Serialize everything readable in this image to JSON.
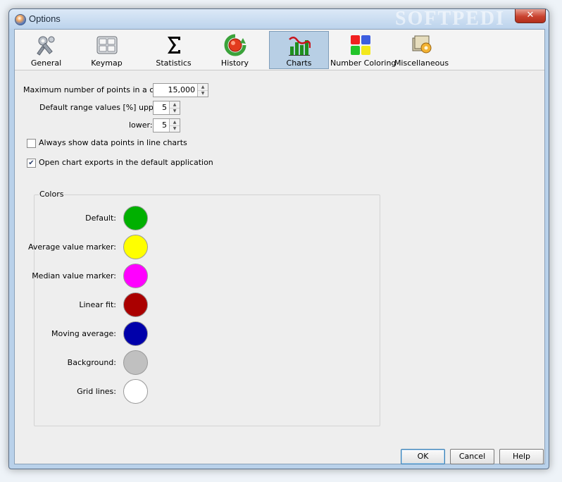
{
  "window": {
    "title": "Options",
    "watermark": "SOFTPEDI",
    "close_glyph": "✕"
  },
  "tabs": [
    {
      "label": "General",
      "icon": "wrench-icon"
    },
    {
      "label": "Keymap",
      "icon": "keyboard-icon"
    },
    {
      "label": "Statistics",
      "icon": "sigma-icon"
    },
    {
      "label": "History",
      "icon": "history-icon"
    },
    {
      "label": "Charts",
      "icon": "chart-icon",
      "active": true
    },
    {
      "label": "Number Coloring",
      "icon": "color-squares-icon"
    },
    {
      "label": "Miscellaneous",
      "icon": "misc-icon"
    }
  ],
  "form": {
    "max_points_label": "Maximum number of points in a chart:",
    "max_points_value": "15,000",
    "range_upper_label": "Default range values [%] upper:",
    "range_upper_value": "5",
    "range_lower_label": "lower:",
    "range_lower_value": "5",
    "always_show_label": "Always show data points in line charts",
    "always_show_checked": false,
    "open_exports_label": "Open chart exports in the default application",
    "open_exports_checked": true,
    "check_glyph": "✔"
  },
  "colors": {
    "title": "Colors",
    "items": [
      {
        "label": "Default:",
        "color": "#00b000"
      },
      {
        "label": "Average value marker:",
        "color": "#ffff00"
      },
      {
        "label": "Median value marker:",
        "color": "#ff00ff"
      },
      {
        "label": "Linear fit:",
        "color": "#aa0000"
      },
      {
        "label": "Moving average:",
        "color": "#0000aa"
      },
      {
        "label": "Background:",
        "color": "#c0c0c0"
      },
      {
        "label": "Grid lines:",
        "color": "#ffffff"
      }
    ]
  },
  "buttons": {
    "ok": "OK",
    "cancel": "Cancel",
    "help": "Help"
  }
}
